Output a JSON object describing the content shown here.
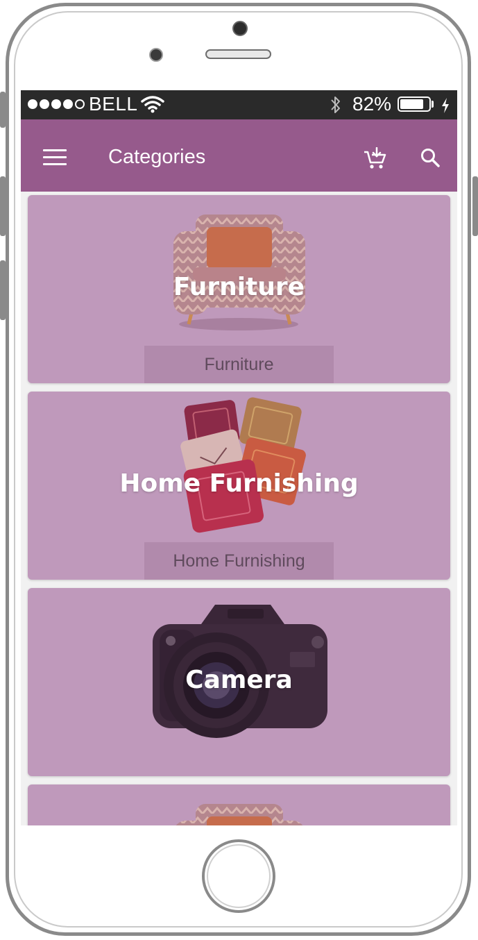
{
  "status_bar": {
    "signal": [
      true,
      true,
      true,
      true,
      false
    ],
    "carrier": "BELL",
    "battery_percent": "82%",
    "battery_level": 0.82
  },
  "app_bar": {
    "title": "Categories",
    "menu_icon": "hamburger-menu-icon",
    "cart_icon": "add-to-cart-icon",
    "search_icon": "search-icon",
    "background": "#965a8c"
  },
  "categories": [
    {
      "title": "Furniture",
      "caption": "Furniture",
      "image": "armchair"
    },
    {
      "title": "Home Furnishing",
      "caption": "Home Furnishing",
      "image": "cushions"
    },
    {
      "title": "Camera",
      "caption": "",
      "image": "dslr-camera"
    },
    {
      "title": "",
      "caption": "",
      "image": "armchair"
    }
  ],
  "colors": {
    "card": "#bf99bb",
    "status_bar": "#2a2a2a"
  }
}
